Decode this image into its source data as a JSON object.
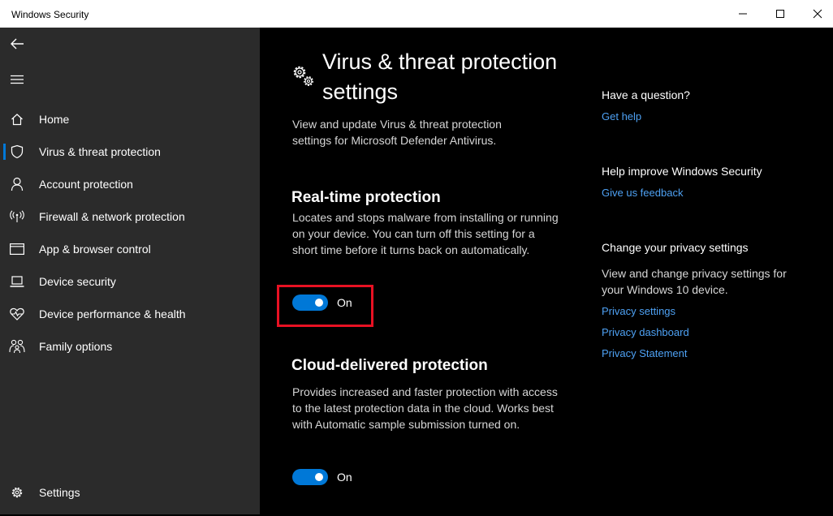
{
  "window": {
    "title": "Windows Security"
  },
  "sidebar": {
    "items": [
      {
        "label": "Home",
        "icon": "home-icon"
      },
      {
        "label": "Virus & threat protection",
        "icon": "shield-icon",
        "active": true
      },
      {
        "label": "Account protection",
        "icon": "person-icon"
      },
      {
        "label": "Firewall & network protection",
        "icon": "wireless-icon"
      },
      {
        "label": "App & browser control",
        "icon": "app-window-icon"
      },
      {
        "label": "Device security",
        "icon": "laptop-icon"
      },
      {
        "label": "Device performance & health",
        "icon": "heart-pulse-icon"
      },
      {
        "label": "Family options",
        "icon": "family-icon"
      }
    ],
    "settings_label": "Settings"
  },
  "main": {
    "title": "Virus & threat protection settings",
    "description": "View and update Virus & threat protection settings for Microsoft Defender Antivirus.",
    "sections": [
      {
        "title": "Real-time protection",
        "description": "Locates and stops malware from installing or running on your device. You can turn off this setting for a short time before it turns back on automatically.",
        "toggle_label": "On",
        "toggle_on": true
      },
      {
        "title": "Cloud-delivered protection",
        "description": "Provides increased and faster protection with access to the latest protection data in the cloud. Works best with Automatic sample submission turned on.",
        "toggle_label": "On",
        "toggle_on": true
      }
    ]
  },
  "right": {
    "question_heading": "Have a question?",
    "get_help": "Get help",
    "improve_heading": "Help improve Windows Security",
    "feedback": "Give us feedback",
    "privacy_heading": "Change your privacy settings",
    "privacy_text": "View and change privacy settings for your Windows 10 device.",
    "privacy_settings": "Privacy settings",
    "privacy_dashboard": "Privacy dashboard",
    "privacy_statement": "Privacy Statement"
  },
  "colors": {
    "accent": "#0078d7",
    "link": "#4ea1f3",
    "highlight": "#e81123",
    "sidebar": "#2b2b2b"
  }
}
